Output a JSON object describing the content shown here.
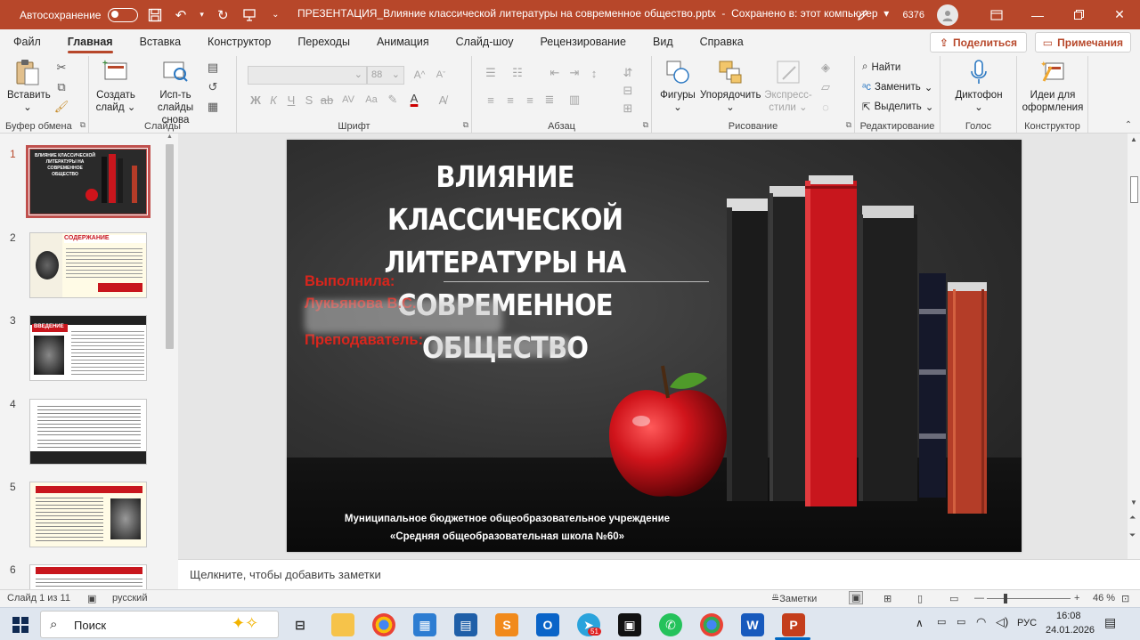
{
  "titlebar": {
    "autosave_label": "Автосохранение",
    "filename": "ПРЕЗЕНТАЦИЯ_Влияние классической литературы на современное общество.pptx",
    "save_status": "Сохранено в: этот компьютер",
    "count": "6376",
    "accent": "#b7472a"
  },
  "menu": {
    "items": [
      "Файл",
      "Главная",
      "Вставка",
      "Конструктор",
      "Переходы",
      "Анимация",
      "Слайд-шоу",
      "Рецензирование",
      "Вид",
      "Справка"
    ],
    "active": "Главная",
    "share": "Поделиться",
    "comments": "Примечания"
  },
  "ribbon": {
    "clipboard": {
      "paste": "Вставить",
      "label": "Буфер обмена"
    },
    "slides": {
      "new_slide_1": "Создать",
      "new_slide_2": "слайд",
      "reuse_1": "Исп-ть",
      "reuse_2": "слайды снова",
      "label": "Слайды"
    },
    "font": {
      "size": "88",
      "label": "Шрифт",
      "bold": "Ж",
      "italic": "К",
      "underline": "Ч",
      "strike": "S",
      "spacing": "AV",
      "case": "Aa",
      "clear": "A"
    },
    "paragraph": {
      "label": "Абзац"
    },
    "drawing": {
      "shapes": "Фигуры",
      "arrange": "Упорядочить",
      "quick_1": "Экспресс-",
      "quick_2": "стили",
      "label": "Рисование"
    },
    "editing": {
      "find": "Найти",
      "replace": "Заменить",
      "select": "Выделить",
      "label": "Редактирование"
    },
    "voice": {
      "dictate": "Диктофон",
      "label": "Голос"
    },
    "designer": {
      "ideas_1": "Идеи для",
      "ideas_2": "оформления",
      "label": "Конструктор"
    }
  },
  "thumbnails": {
    "numbers": [
      "1",
      "2",
      "3",
      "4",
      "5",
      "6"
    ],
    "t2_title": "СОДЕРЖАНИЕ",
    "t3_title": "ВВЕДЕНИЕ"
  },
  "slide": {
    "title_lines": [
      "ВЛИЯНИЕ КЛАССИЧЕСКОЙ",
      "ЛИТЕРАТУРЫ НА",
      "СОВРЕМЕННОЕ ОБЩЕСТВО"
    ],
    "author_label": "Выполнила:",
    "author_name": "Лукьянова В.С.",
    "teacher_label": "Преподаватель:",
    "school_line1": "Муниципальное бюджетное общеобразовательное учреждение",
    "school_line2": "«Средняя общеобразовательная школа №60»"
  },
  "notes_placeholder": "Щелкните, чтобы добавить заметки",
  "status": {
    "slide_counter": "Слайд 1 из 11",
    "language": "русский",
    "notes_btn": "Заметки",
    "zoom": "46 %"
  },
  "taskbar": {
    "search": "Поиск",
    "lang": "РУС",
    "time": "16:08",
    "date": "24.01.2026",
    "telegram_badge": "51"
  }
}
